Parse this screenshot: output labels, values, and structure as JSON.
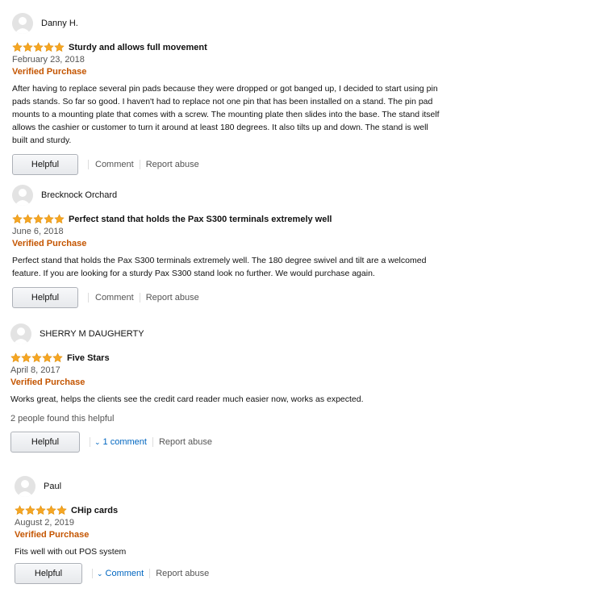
{
  "reviews": [
    {
      "author": "Danny H.",
      "rating": 5,
      "title": "Sturdy and allows full movement",
      "date": "February 23, 2018",
      "verified": "Verified Purchase",
      "body_lines": [
        "After having to replace several pin pads because they were dropped or got banged up, I decided to start using pin",
        "pads stands. So far so good. I haven't had to replace not one pin that has been installed on a stand. The pin pad",
        "mounts to a mounting plate that comes with a screw. The mounting plate then slides into the base. The stand itself",
        "allows the cashier or customer to turn it around at least 180 degrees. It also tilts up and down. The stand is well",
        "built and sturdy."
      ],
      "helpful_label": "Helpful",
      "comment_label": "Comment",
      "report_label": "Report abuse"
    },
    {
      "author": "Brecknock Orchard",
      "rating": 5,
      "title": "Perfect stand that holds the Pax S300 terminals extremely well",
      "date": "June 6, 2018",
      "verified": "Verified Purchase",
      "body_lines": [
        "Perfect stand that holds the Pax S300 terminals extremely well. The 180 degree swivel and tilt are a welcomed",
        "feature. If you are looking for a sturdy Pax S300 stand look no further. We would purchase again."
      ],
      "helpful_label": "Helpful",
      "comment_label": "Comment",
      "report_label": "Report abuse"
    },
    {
      "author": "SHERRY M DAUGHERTY",
      "rating": 5,
      "title": "Five Stars",
      "date": "April 8, 2017",
      "verified": "Verified Purchase",
      "body_lines": [
        "Works great, helps the clients see the credit card reader much easier now, works as expected."
      ],
      "helpful_count": "2 people found this helpful",
      "helpful_label": "Helpful",
      "comment_label": "1 comment",
      "report_label": "Report abuse"
    },
    {
      "author": "Paul",
      "rating": 5,
      "title": "CHip cards",
      "date": "August 2, 2019",
      "verified": "Verified Purchase",
      "body_lines": [
        "Fits well with out POS system"
      ],
      "helpful_label": "Helpful",
      "comment_label": "Comment",
      "report_label": "Report abuse"
    }
  ],
  "colors": {
    "star": "#f5a623",
    "star_stroke": "#e08e0b",
    "verified": "#c45500",
    "link": "#0066c0"
  },
  "icons": {
    "avatar": "user-silhouette-icon",
    "star": "star-icon",
    "chevron": "chevron-down-icon"
  }
}
